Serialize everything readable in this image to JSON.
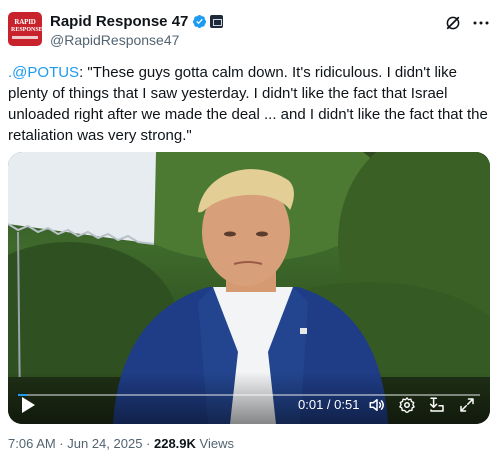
{
  "account": {
    "display_name": "Rapid Response 47",
    "handle": "@RapidResponse47",
    "avatar_text_line1": "RAPID",
    "avatar_text_line2": "RESPONSE",
    "verified_color": "#1d9bf0"
  },
  "tweet": {
    "mention": ".@POTUS",
    "text": ": \"These guys gotta calm down. It's ridiculous. I didn't like plenty of things that I saw yesterday. I didn't like the fact that Israel unloaded right after we made the deal ... and I didn't like the fact that the retaliation was very strong.\""
  },
  "video": {
    "time_display": "0:01 / 0:51",
    "progress_fraction": 0.02
  },
  "meta": {
    "timestamp": "7:06 AM · Jun 24, 2025 · ",
    "views_count": "228.9K",
    "views_label": " Views"
  },
  "icons": {
    "grok": "grok-icon",
    "more": "more-icon",
    "play": "play-icon",
    "volume": "volume-icon",
    "settings": "gear-icon",
    "popout": "popout-icon",
    "fullscreen": "fullscreen-icon"
  }
}
